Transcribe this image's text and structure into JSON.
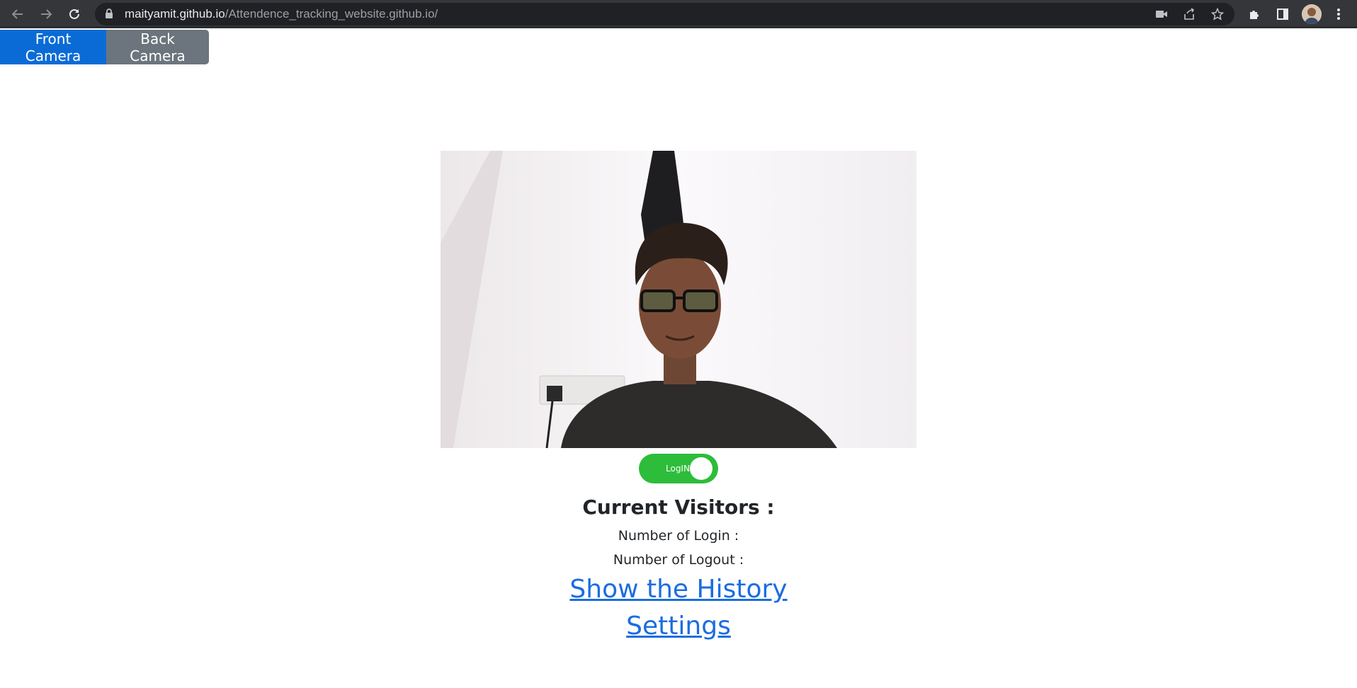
{
  "browser": {
    "url_host": "maityamit.github.io",
    "url_path": "/Attendence_tracking_website.github.io/",
    "icons": [
      "back-arrow-icon",
      "forward-arrow-icon",
      "reload-icon",
      "lock-icon",
      "camera-icon",
      "share-icon",
      "star-icon",
      "extensions-icon",
      "side-panel-icon",
      "profile-avatar",
      "menu-dots-icon"
    ]
  },
  "camera_controls": {
    "front_label": "Front Camera",
    "back_label": "Back Camera",
    "front_color": "#0b6bd6",
    "back_color": "#6c757d"
  },
  "toggle": {
    "label": "LogIN",
    "state": "on",
    "color": "#2dbd3a"
  },
  "stats": {
    "title": "Current Visitors :",
    "login_label": "Number of Login :",
    "logout_label": "Number of Logout :"
  },
  "links": {
    "history": "Show the History",
    "settings": "Settings",
    "color": "#1a6de0"
  }
}
